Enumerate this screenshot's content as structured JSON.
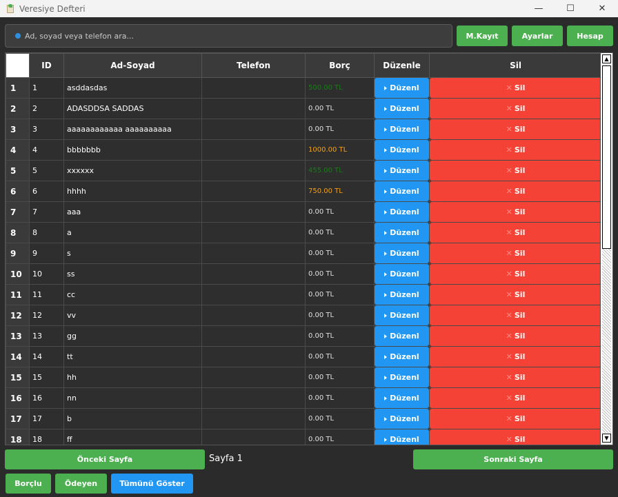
{
  "window": {
    "title": "Veresiye Defteri",
    "minimize": "—",
    "maximize": "☐",
    "close": "✕"
  },
  "search": {
    "placeholder": "Ad, soyad veya telefon ara...",
    "value": ""
  },
  "top_buttons": {
    "mkayit": "M.Kayıt",
    "ayarlar": "Ayarlar",
    "hesap": "Hesap"
  },
  "table": {
    "columns": [
      "ID",
      "Ad-Soyad",
      "Telefon",
      "Borç",
      "Düzenle",
      "Sil"
    ],
    "edit_label": "Düzenl",
    "delete_label": "Sil",
    "colors": {
      "positive_green": "#1b7a1b",
      "orange": "#f0a020",
      "zero": "#e0e0e0"
    },
    "rows": [
      {
        "row": "1",
        "id": "1",
        "name": "asddasdas",
        "phone": "",
        "borc": "500.00 TL",
        "tone": "green"
      },
      {
        "row": "2",
        "id": "2",
        "name": "ADASDDSA SADDAS",
        "phone": "",
        "borc": "0.00 TL",
        "tone": "zero"
      },
      {
        "row": "3",
        "id": "3",
        "name": "aaaaaaaaaaaa aaaaaaaaaa",
        "phone": "",
        "borc": "0.00 TL",
        "tone": "zero"
      },
      {
        "row": "4",
        "id": "4",
        "name": "bbbbbbb",
        "phone": "",
        "borc": "1000.00 TL",
        "tone": "orange"
      },
      {
        "row": "5",
        "id": "5",
        "name": "xxxxxx",
        "phone": "",
        "borc": "455.00 TL",
        "tone": "green"
      },
      {
        "row": "6",
        "id": "6",
        "name": "hhhh",
        "phone": "",
        "borc": "750.00 TL",
        "tone": "orange"
      },
      {
        "row": "7",
        "id": "7",
        "name": "aaa",
        "phone": "",
        "borc": "0.00 TL",
        "tone": "zero"
      },
      {
        "row": "8",
        "id": "8",
        "name": "a",
        "phone": "",
        "borc": "0.00 TL",
        "tone": "zero"
      },
      {
        "row": "9",
        "id": "9",
        "name": "s",
        "phone": "",
        "borc": "0.00 TL",
        "tone": "zero"
      },
      {
        "row": "10",
        "id": "10",
        "name": "ss",
        "phone": "",
        "borc": "0.00 TL",
        "tone": "zero"
      },
      {
        "row": "11",
        "id": "11",
        "name": "cc",
        "phone": "",
        "borc": "0.00 TL",
        "tone": "zero"
      },
      {
        "row": "12",
        "id": "12",
        "name": "vv",
        "phone": "",
        "borc": "0.00 TL",
        "tone": "zero"
      },
      {
        "row": "13",
        "id": "13",
        "name": "gg",
        "phone": "",
        "borc": "0.00 TL",
        "tone": "zero"
      },
      {
        "row": "14",
        "id": "14",
        "name": "tt",
        "phone": "",
        "borc": "0.00 TL",
        "tone": "zero"
      },
      {
        "row": "15",
        "id": "15",
        "name": "hh",
        "phone": "",
        "borc": "0.00 TL",
        "tone": "zero"
      },
      {
        "row": "16",
        "id": "16",
        "name": "nn",
        "phone": "",
        "borc": "0.00 TL",
        "tone": "zero"
      },
      {
        "row": "17",
        "id": "17",
        "name": "b",
        "phone": "",
        "borc": "0.00 TL",
        "tone": "zero"
      },
      {
        "row": "18",
        "id": "18",
        "name": "ff",
        "phone": "",
        "borc": "0.00 TL",
        "tone": "zero"
      }
    ]
  },
  "pagination": {
    "prev": "Önceki Sayfa",
    "page_label": "Sayfa 1",
    "next": "Sonraki Sayfa"
  },
  "filters": {
    "borclu": "Borçlu",
    "odeyen": "Ödeyen",
    "tumu": "Tümünü Göster"
  }
}
